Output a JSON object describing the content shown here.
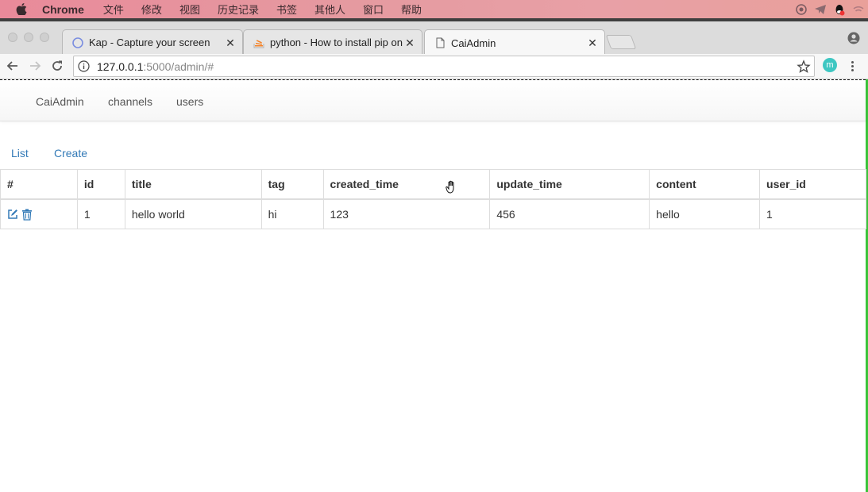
{
  "menubar": {
    "app_name": "Chrome",
    "items": [
      "文件",
      "修改",
      "视图",
      "历史记录",
      "书签",
      "其他人",
      "窗口",
      "帮助"
    ]
  },
  "tabs": [
    {
      "title": "Kap - Capture your screen",
      "icon": "kap-icon"
    },
    {
      "title": "python - How to install pip on m",
      "icon": "stackoverflow-icon"
    },
    {
      "title": "CaiAdmin",
      "icon": "page-icon"
    }
  ],
  "address": {
    "host": "127.0.0.1",
    "path": ":5000/admin/#"
  },
  "extension_letter": "m",
  "nav": {
    "brand": "CaiAdmin",
    "items": [
      "channels",
      "users"
    ]
  },
  "subnav": {
    "list": "List",
    "create": "Create"
  },
  "table": {
    "headers": [
      "#",
      "id",
      "title",
      "tag",
      "created_time",
      "update_time",
      "content",
      "user_id"
    ],
    "rows": [
      {
        "id": "1",
        "title": "hello world",
        "tag": "hi",
        "created_time": "123",
        "update_time": "456",
        "content": "hello",
        "user_id": "1"
      }
    ]
  },
  "colors": {
    "link": "#337ab7",
    "accent_green": "#3ac43a"
  }
}
